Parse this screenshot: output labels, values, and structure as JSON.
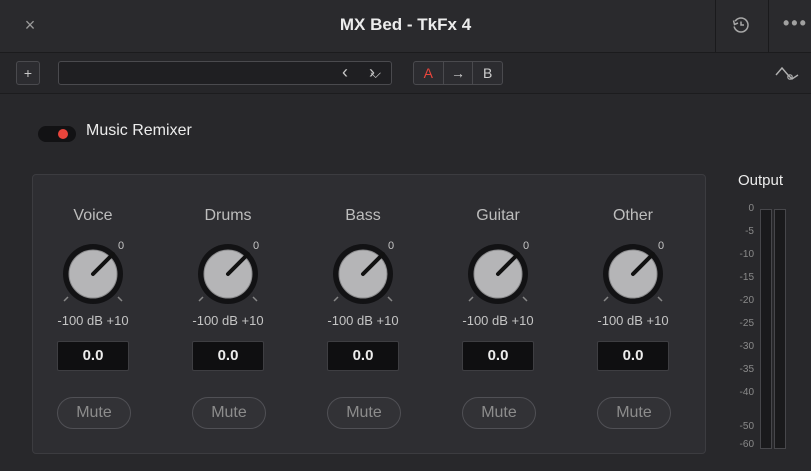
{
  "window": {
    "title": "MX Bed - TkFx 4",
    "close_glyph": "×",
    "more_glyph": "•••"
  },
  "toolbar": {
    "add_glyph": "+",
    "preset_value": "",
    "chevron_glyph": "⌵",
    "prev_glyph": "‹",
    "next_glyph": "›",
    "ab": {
      "a": "A",
      "arrow": "→",
      "b": "B"
    }
  },
  "effect": {
    "name": "Music Remixer",
    "enabled": true,
    "accent_color": "#e8453c"
  },
  "channels": [
    {
      "name": "Voice",
      "top_label": "0",
      "range": "-100  dB  +10",
      "value": "0.0",
      "mute": "Mute"
    },
    {
      "name": "Drums",
      "top_label": "0",
      "range": "-100  dB  +10",
      "value": "0.0",
      "mute": "Mute"
    },
    {
      "name": "Bass",
      "top_label": "0",
      "range": "-100  dB  +10",
      "value": "0.0",
      "mute": "Mute"
    },
    {
      "name": "Guitar",
      "top_label": "0",
      "range": "-100  dB  +10",
      "value": "0.0",
      "mute": "Mute"
    },
    {
      "name": "Other",
      "top_label": "0",
      "range": "-100  dB  +10",
      "value": "0.0",
      "mute": "Mute"
    }
  ],
  "output": {
    "title": "Output",
    "scale": [
      "0",
      "-5",
      "-10",
      "-15",
      "-20",
      "-25",
      "-30",
      "-35",
      "-40",
      "-50",
      "-60"
    ]
  }
}
